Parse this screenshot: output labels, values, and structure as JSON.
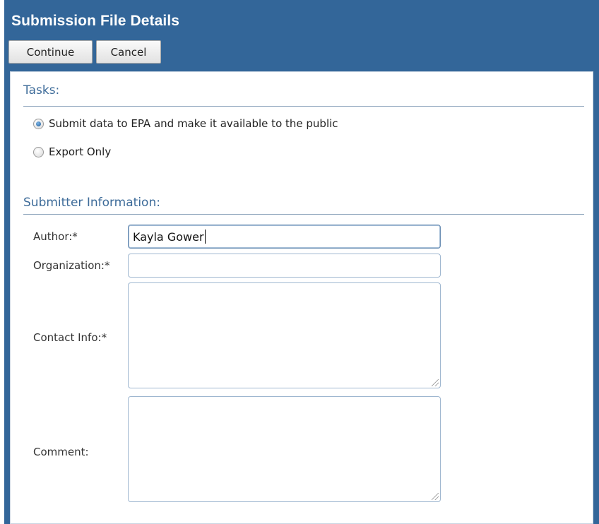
{
  "window": {
    "title": "Submission File Details"
  },
  "toolbar": {
    "continue_label": "Continue",
    "cancel_label": "Cancel"
  },
  "tasks": {
    "heading": "Tasks:",
    "options": [
      {
        "label": "Submit data to EPA and make it available to the public",
        "selected": true
      },
      {
        "label": "Export Only",
        "selected": false
      }
    ]
  },
  "submitter": {
    "heading": "Submitter Information:",
    "author": {
      "label": "Author:*",
      "value": "Kayla Gower"
    },
    "organization": {
      "label": "Organization:*",
      "value": ""
    },
    "contact": {
      "label": "Contact Info:*",
      "value": ""
    },
    "comment": {
      "label": "Comment:",
      "value": ""
    }
  },
  "colors": {
    "header": "#336699",
    "section_heading": "#3d6b99",
    "field_border": "#9fb7d0"
  }
}
